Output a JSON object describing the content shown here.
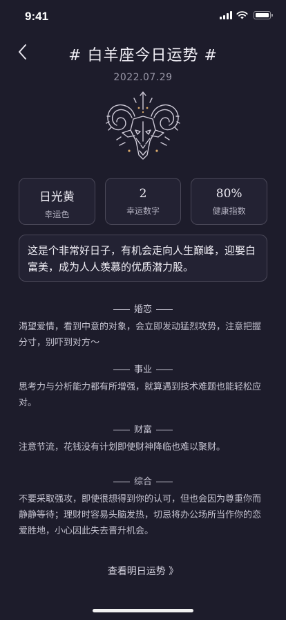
{
  "status": {
    "time": "9:41"
  },
  "nav": {
    "title": "# 白羊座今日运势 #"
  },
  "date": "2022.07.29",
  "emblem_icon": "aries-ram-icon",
  "stats": [
    {
      "value": "日光黄",
      "label": "幸运色"
    },
    {
      "value": "2",
      "label": "幸运数字"
    },
    {
      "value": "80%",
      "label": "健康指数"
    }
  ],
  "summary": "这是个非常好日子，有机会走向人生巅峰，迎娶白富美，成为人人羡慕的优质潜力股。",
  "sections": [
    {
      "title": "婚恋",
      "body": "渴望爱情，看到中意的对象，会立即发动猛烈攻势，注意把握分寸，别吓到对方～"
    },
    {
      "title": "事业",
      "body": "思考力与分析能力都有所增强，就算遇到技术难题也能轻松应对。"
    },
    {
      "title": "财富",
      "body": "注意节流，花钱没有计划即使财神降临也难以聚财。"
    },
    {
      "title": "综合",
      "body": "不要采取强攻，即使很想得到你的认可，但也会因为尊重你而静静等待；理财时容易头脑发热，切忌将办公场所当作你的恋爱胜地，小心因此失去晋升机会。"
    }
  ],
  "next_link": "查看明日运势 》"
}
